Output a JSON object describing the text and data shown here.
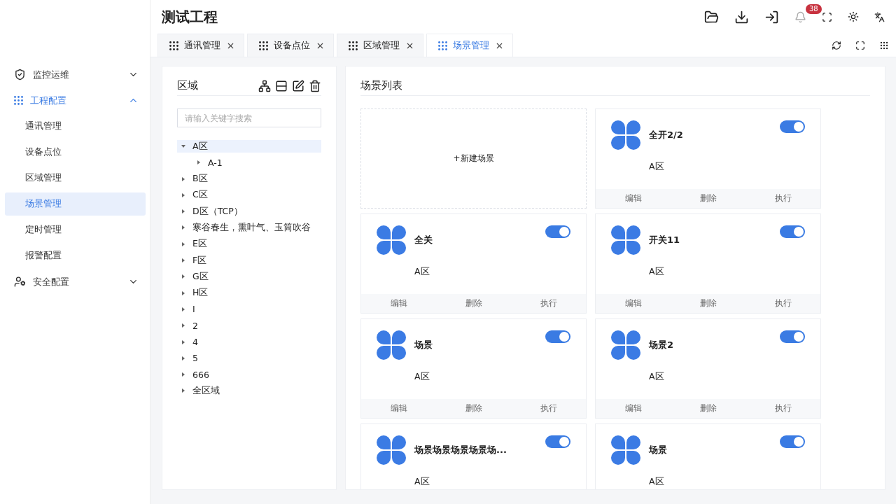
{
  "sidebar": {
    "menu": [
      {
        "label": "监控运维",
        "selected": false,
        "expanded": false
      },
      {
        "label": "工程配置",
        "selected": true,
        "expanded": true,
        "children": [
          {
            "label": "通讯管理",
            "selected": false
          },
          {
            "label": "设备点位",
            "selected": false
          },
          {
            "label": "区域管理",
            "selected": false
          },
          {
            "label": "场景管理",
            "selected": true
          },
          {
            "label": "定时管理",
            "selected": false
          },
          {
            "label": "报警配置",
            "selected": false
          }
        ]
      },
      {
        "label": "安全配置",
        "selected": false,
        "expanded": false
      }
    ]
  },
  "header": {
    "title": "测试工程",
    "notification_count": "38"
  },
  "tabs": [
    {
      "label": "通讯管理",
      "selected": false
    },
    {
      "label": "设备点位",
      "selected": false
    },
    {
      "label": "区域管理",
      "selected": false
    },
    {
      "label": "场景管理",
      "selected": true
    }
  ],
  "tree_panel": {
    "title": "区域",
    "search": {
      "placeholder": "请输入关键字搜索"
    },
    "nodes": [
      {
        "label": "A区",
        "expanded": true,
        "selected": true,
        "children": [
          {
            "label": "A-1",
            "expanded": false,
            "selected": false
          }
        ]
      },
      {
        "label": "B区",
        "expanded": false,
        "selected": false
      },
      {
        "label": "C区",
        "expanded": false,
        "selected": false
      },
      {
        "label": "D区（TCP）",
        "expanded": false,
        "selected": false
      },
      {
        "label": "寒谷春生，熏叶气、玉筒吹谷",
        "expanded": false,
        "selected": false
      },
      {
        "label": "E区",
        "expanded": false,
        "selected": false
      },
      {
        "label": "F区",
        "expanded": false,
        "selected": false
      },
      {
        "label": "G区",
        "expanded": false,
        "selected": false
      },
      {
        "label": "H区",
        "expanded": false,
        "selected": false
      },
      {
        "label": "I",
        "expanded": false,
        "selected": false
      },
      {
        "label": "2",
        "expanded": false,
        "selected": false
      },
      {
        "label": "4",
        "expanded": false,
        "selected": false
      },
      {
        "label": "5",
        "expanded": false,
        "selected": false
      },
      {
        "label": "666",
        "expanded": false,
        "selected": false
      },
      {
        "label": "全区域",
        "expanded": false,
        "selected": false
      }
    ]
  },
  "scene_panel": {
    "title": "场景列表",
    "new_scene": "+新建场景",
    "scenes": [
      {
        "name": "全开2/2",
        "area": "A区",
        "on": true,
        "actions": [
          "编辑",
          "删除",
          "执行"
        ]
      },
      {
        "name": "全关",
        "area": "A区",
        "on": true,
        "actions": [
          "编辑",
          "删除",
          "执行"
        ]
      },
      {
        "name": "开关11",
        "area": "A区",
        "on": true,
        "actions": [
          "编辑",
          "删除",
          "执行"
        ]
      },
      {
        "name": "场景",
        "area": "A区",
        "on": true,
        "actions": [
          "编辑",
          "删除",
          "执行"
        ]
      },
      {
        "name": "场景2",
        "area": "A区",
        "on": true,
        "actions": [
          "编辑",
          "删除",
          "执行"
        ]
      },
      {
        "name": "场景场景场景场景场...",
        "area": "A区",
        "on": true
      },
      {
        "name": "场景",
        "area": "A区",
        "on": true
      }
    ]
  }
}
